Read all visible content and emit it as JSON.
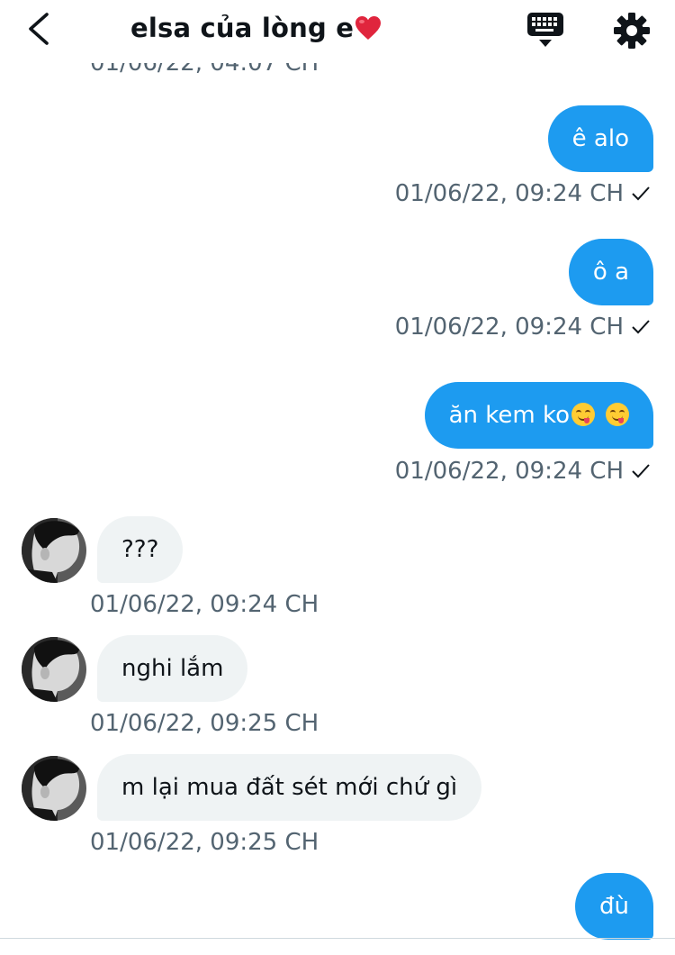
{
  "header": {
    "title": "elsa của lòng e",
    "title_emoji": "heart-emoji"
  },
  "clipped_timestamp": "01/06/22, 04:07 CH",
  "messages": [
    {
      "direction": "outgoing",
      "text": "ê alo",
      "timestamp": "01/06/22, 09:24 CH",
      "read": true
    },
    {
      "direction": "outgoing",
      "text": "ô a",
      "timestamp": "01/06/22, 09:24 CH",
      "read": true
    },
    {
      "direction": "outgoing",
      "text": "ăn kem ko",
      "emojis": [
        "yum-emoji",
        "yum-emoji"
      ],
      "timestamp": "01/06/22, 09:24 CH",
      "read": true
    },
    {
      "direction": "incoming",
      "text": "???",
      "timestamp": "01/06/22, 09:24 CH"
    },
    {
      "direction": "incoming",
      "text": "nghi lắm",
      "timestamp": "01/06/22, 09:25 CH"
    },
    {
      "direction": "incoming",
      "text": "m lại mua đất sét mới chứ gì",
      "timestamp": "01/06/22, 09:25 CH"
    },
    {
      "direction": "outgoing",
      "text": "đù"
    }
  ],
  "icons": {
    "back": "back-arrow-icon",
    "keyboard": "keyboard-icon",
    "settings": "gear-icon",
    "read_receipt": "check-icon"
  },
  "colors": {
    "outgoing_bubble": "#1d9bf0",
    "incoming_bubble": "#eff3f4",
    "timestamp": "#536471",
    "text": "#0f1419"
  }
}
